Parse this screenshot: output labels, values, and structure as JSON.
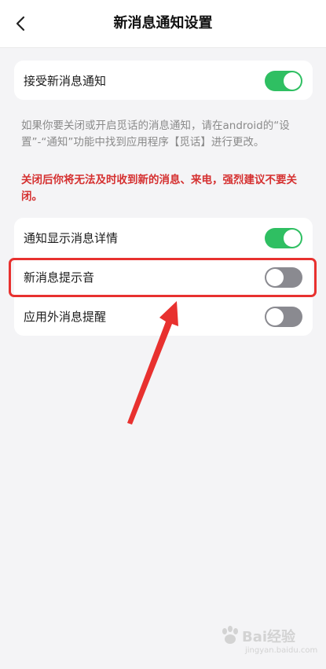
{
  "header": {
    "title": "新消息通知设置"
  },
  "card1": {
    "items": [
      {
        "label": "接受新消息通知",
        "state": "on"
      }
    ]
  },
  "info": {
    "text": "如果你要关闭或开启觅话的消息通知，请在android的“设置”-“通知”功能中找到应用程序【觅话】进行更改。",
    "warning": "关闭后你将无法及时收到新的消息、来电，强烈建议不要关闭。"
  },
  "card2": {
    "items": [
      {
        "label": "通知显示消息详情",
        "state": "on"
      },
      {
        "label": "新消息提示音",
        "state": "off"
      },
      {
        "label": "应用外消息提醒",
        "state": "off"
      }
    ]
  },
  "colors": {
    "toggle_on": "#2fbf62",
    "toggle_off": "#8a8a90",
    "warning": "#d53030",
    "annotation": "#e8312f"
  },
  "watermark": {
    "text": "Bai经验",
    "site": "jingyan.baidu.com"
  },
  "icons": {
    "back": "chevron-left-icon"
  }
}
